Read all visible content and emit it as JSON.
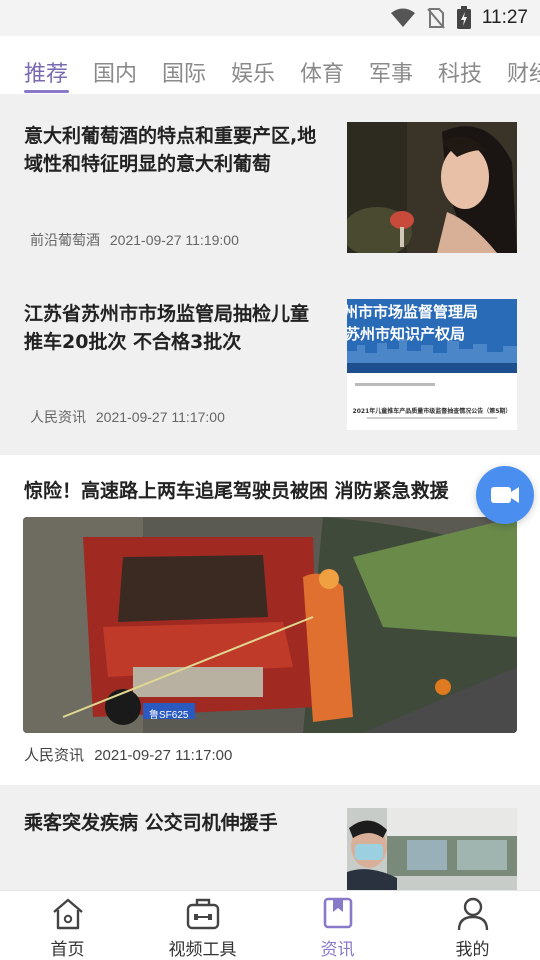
{
  "status_bar": {
    "time": "11:27"
  },
  "tabs": [
    {
      "label": "推荐",
      "active": true
    },
    {
      "label": "国内"
    },
    {
      "label": "国际"
    },
    {
      "label": "娱乐"
    },
    {
      "label": "体育"
    },
    {
      "label": "军事"
    },
    {
      "label": "科技"
    },
    {
      "label": "财经"
    }
  ],
  "feed": [
    {
      "title_line1": "意大利葡萄酒的特点和重要产区,地",
      "title_line2": "域性和特征明显的意大利葡萄",
      "source": "前沿葡萄酒",
      "time": "2021-09-27 11:19:00"
    },
    {
      "title_line1": "江苏省苏州市市场监管局抽检儿童",
      "title_line2": "推车20批次 不合格3批次",
      "source": "人民资讯",
      "time": "2021-09-27 11:17:00",
      "thumb_text_1": "州市市场监督管理局",
      "thumb_text_2": "苏州市知识产权局",
      "thumb_caption": "2021年儿童推车产品质量市级监督抽查情况公告（第5期）"
    },
    {
      "title": "惊险！高速路上两车追尾驾驶员被困 消防紧急救援",
      "source": "人民资讯",
      "time": "2021-09-27 11:17:00",
      "plate": "鲁SF625"
    },
    {
      "title": "乘客突发疾病 公交司机伸援手"
    }
  ],
  "fab": {
    "icon": "video-camera-icon"
  },
  "bottom_nav": [
    {
      "label": "首页",
      "icon": "home-icon"
    },
    {
      "label": "视频工具",
      "icon": "toolbox-icon"
    },
    {
      "label": "资讯",
      "icon": "bookmark-icon",
      "active": true
    },
    {
      "label": "我的",
      "icon": "person-icon"
    }
  ],
  "colors": {
    "accent": "#8a78c8",
    "fab": "#4a8ff0"
  }
}
